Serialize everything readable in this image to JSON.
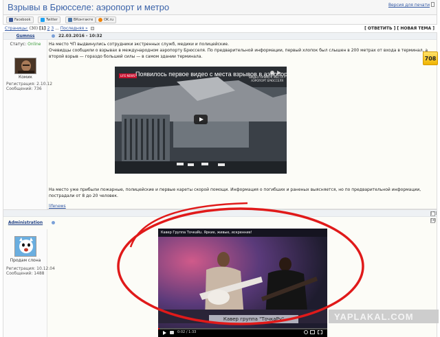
{
  "topic": {
    "title": "Взрывы в Брюсселе: аэропорт и метро",
    "print_link": "Версия для печати"
  },
  "share": [
    {
      "label": "Facebook",
      "color": "#3b5998",
      "icon": "facebook-icon"
    },
    {
      "label": "Twitter",
      "color": "#1da1f2",
      "icon": "twitter-icon"
    },
    {
      "label": "ВКонтакте",
      "color": "#4a76a8",
      "icon": "vk-icon"
    },
    {
      "label": "OK.ru",
      "color": "#ee8208",
      "icon": "odnoklassniki-icon"
    }
  ],
  "pagination": {
    "pages_label": "Страницы:",
    "total": "(30)",
    "current": "[1]",
    "p2": "2",
    "p3": "3",
    "ellipsis": "...",
    "last": "Последняя »"
  },
  "actions": {
    "reply": "[ ОТВЕТИТЬ ]",
    "new_topic": "[ НОВАЯ ТЕМА ]"
  },
  "post1": {
    "username": "Gumnss",
    "date": "22.03.2016 - 10:32",
    "status_label": "Статус:",
    "status": "Online",
    "rank": "Комик",
    "reg": "Регистрация: 2.10.12",
    "msgs": "Сообщений: 736",
    "para1": "На место ЧП выдвинулись сотрудники экстренных служб, медики и полицейские.",
    "para2": "Очевидцы сообщили о взрывах в международном аэропорту Брюсселя. По предварительной информации, первый хлопок был слышен в 200 метрах от входа в терминал, а второй взрыв — гораздо большей силы — в самом здании терминала.",
    "video_title": "Появилось первое видео с места взрывов в аэропор...",
    "video_logo": "LIFE NEWS",
    "video_caption_1": "ВИДЕО ПРЯМО С МЕСТА",
    "video_caption_2": "АЭРОПОРТ БРЮССЕЛЯ",
    "para3": "На место уже прибыли пожарные, полицейские и первые кареты скорой помощи. Информация о погибших и раненых выясняется, но по предварительной информации, пострадали от 8 до 20 человек.",
    "source": "lifenews",
    "rating": "708"
  },
  "post2": {
    "username": "Administration",
    "rank": "Продам слона",
    "reg": "Регистрация: 10.12.04",
    "msgs": "Сообщений: 1488",
    "video_title": "Кавер Группа ТочкаRu. Яркие, живые, искренние!",
    "video_caption": "Кавер группа \"ТочкаРу\"",
    "video_time": "0:02 / 1:33"
  },
  "watermark": "YAPLAKAL.COM",
  "ctrl_up": "[^]",
  "ctrl_x": "[x]"
}
